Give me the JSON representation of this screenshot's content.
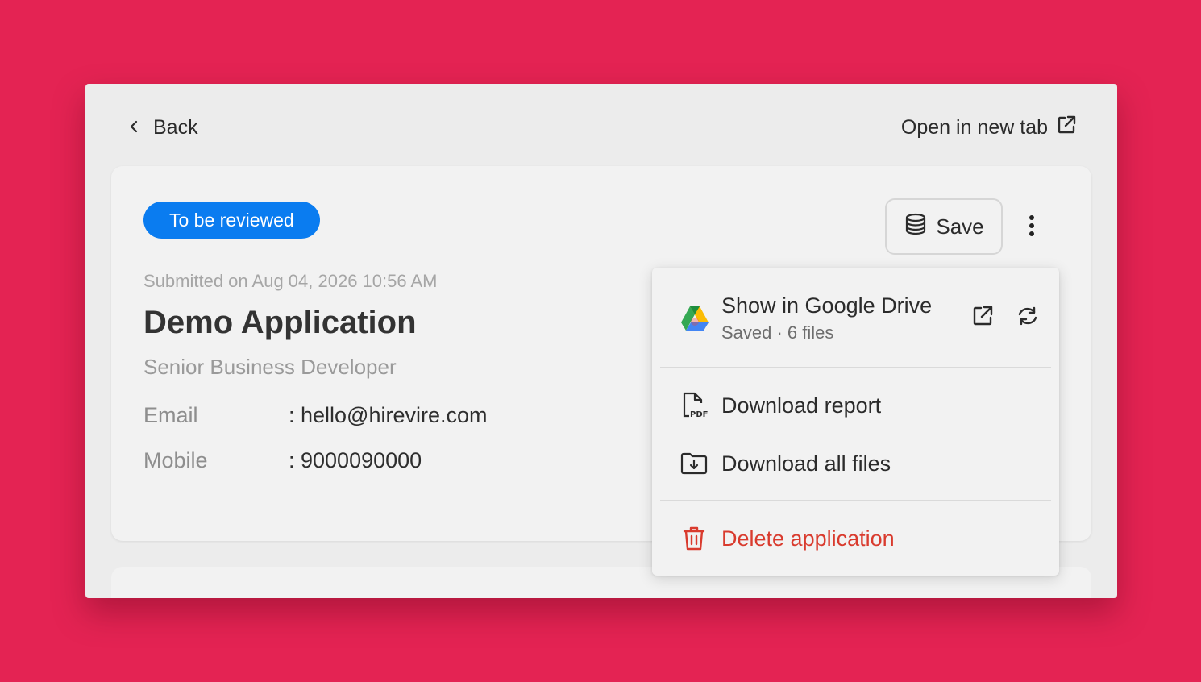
{
  "topbar": {
    "back_label": "Back",
    "open_new_tab_label": "Open in new tab"
  },
  "application": {
    "status_badge": "To be reviewed",
    "submitted_on": "Submitted on Aug 04, 2026 10:56 AM",
    "title": "Demo Application",
    "role": "Senior Business Developer",
    "fields": [
      {
        "label": "Email",
        "value": ": hello@hirevire.com"
      },
      {
        "label": "Mobile",
        "value": ": 9000090000"
      }
    ]
  },
  "actions": {
    "save_label": "Save"
  },
  "menu": {
    "google_drive": {
      "title": "Show in Google Drive",
      "subtitle": "Saved · 6 files"
    },
    "download_report": "Download report",
    "download_all": "Download all files",
    "delete": "Delete application"
  },
  "colors": {
    "background": "#e42353",
    "accent": "#0a7cf0",
    "danger": "#d93b2e"
  },
  "icons": [
    "chevron-left-icon",
    "external-link-icon",
    "database-icon",
    "kebab-icon",
    "google-drive-icon",
    "sync-icon",
    "pdf-file-icon",
    "folder-download-icon",
    "trash-icon"
  ]
}
